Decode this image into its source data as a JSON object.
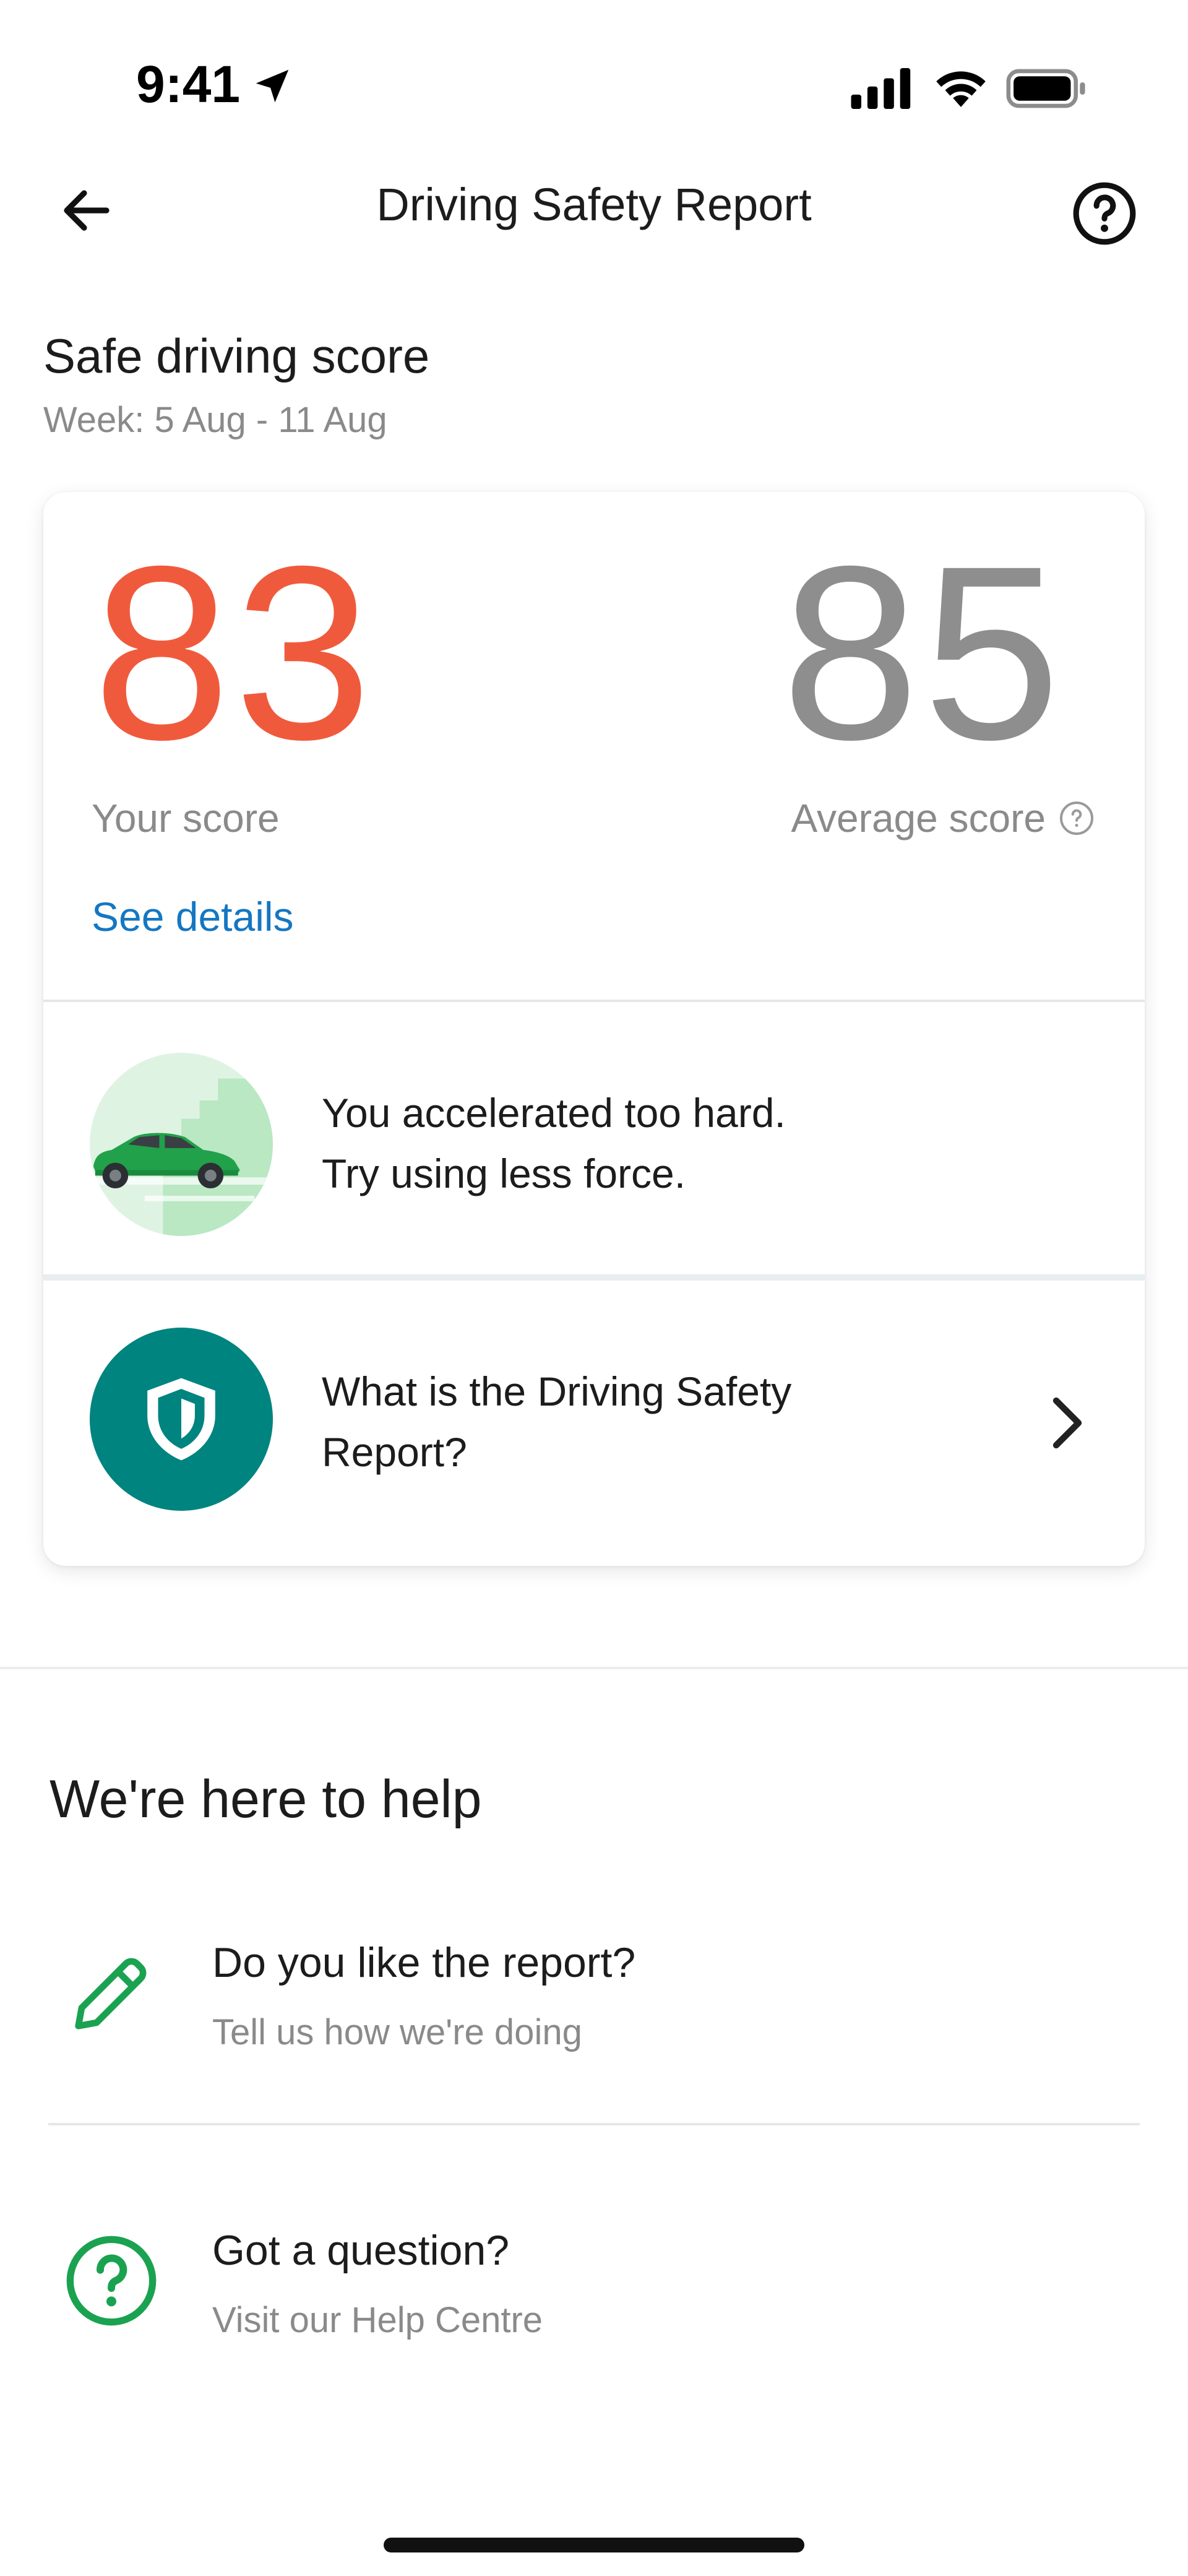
{
  "status_bar": {
    "time": "9:41",
    "icons": [
      "location-arrow-icon",
      "cellular-signal-icon",
      "wifi-icon",
      "battery-icon"
    ]
  },
  "header": {
    "title": "Driving Safety Report",
    "back_icon": "arrow-left-icon",
    "help_icon": "question-circle-icon"
  },
  "score_section": {
    "title": "Safe driving score",
    "week": "Week: 5 Aug - 11 Aug"
  },
  "card": {
    "your_score": "83",
    "your_score_label": "Your score",
    "average_score": "85",
    "average_score_label": "Average score",
    "see_details_label": "See details",
    "tip_line1": "You accelerated too hard.",
    "tip_line2": "Try using less force.",
    "about_line1": "What is the Driving Safety",
    "about_line2": "Report?"
  },
  "help_section": {
    "title": "We're here to help",
    "items": [
      {
        "title": "Do you like the report?",
        "subtitle": "Tell us how we're doing",
        "icon": "pencil-icon"
      },
      {
        "title": "Got a question?",
        "subtitle": "Visit our Help Centre",
        "icon": "question-circle-icon"
      }
    ]
  },
  "colors": {
    "your_score": "#f05a3c",
    "average_score": "#8e8e8e",
    "link": "#1477c2",
    "teal": "#00847f",
    "green": "#1aa251"
  }
}
